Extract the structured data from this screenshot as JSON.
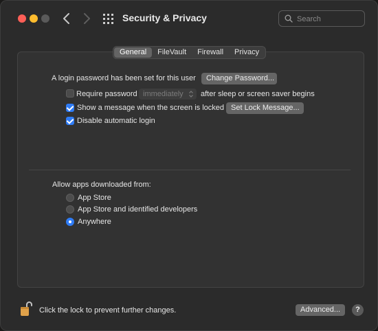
{
  "window": {
    "title": "Security & Privacy",
    "search_placeholder": "Search"
  },
  "tabs": [
    {
      "label": "General",
      "active": true
    },
    {
      "label": "FileVault",
      "active": false
    },
    {
      "label": "Firewall",
      "active": false
    },
    {
      "label": "Privacy",
      "active": false
    }
  ],
  "general": {
    "login_password_text": "A login password has been set for this user",
    "change_password_label": "Change Password...",
    "require_password": {
      "label": "Require password",
      "checked": false,
      "select_value": "immediately",
      "suffix": "after sleep or screen saver begins"
    },
    "show_message": {
      "label": "Show a message when the screen is locked",
      "checked": true,
      "button_label": "Set Lock Message..."
    },
    "disable_auto_login": {
      "label": "Disable automatic login",
      "checked": true
    }
  },
  "allow_apps": {
    "heading": "Allow apps downloaded from:",
    "options": [
      {
        "label": "App Store",
        "selected": false
      },
      {
        "label": "App Store and identified developers",
        "selected": false
      },
      {
        "label": "Anywhere",
        "selected": true
      }
    ]
  },
  "footer": {
    "lock_text": "Click the lock to prevent further changes.",
    "advanced_label": "Advanced...",
    "help_label": "?"
  },
  "colors": {
    "accent": "#2f7cf6",
    "close": "#fe5f57",
    "minimize": "#febc2e",
    "lock": "#e0a24a"
  }
}
